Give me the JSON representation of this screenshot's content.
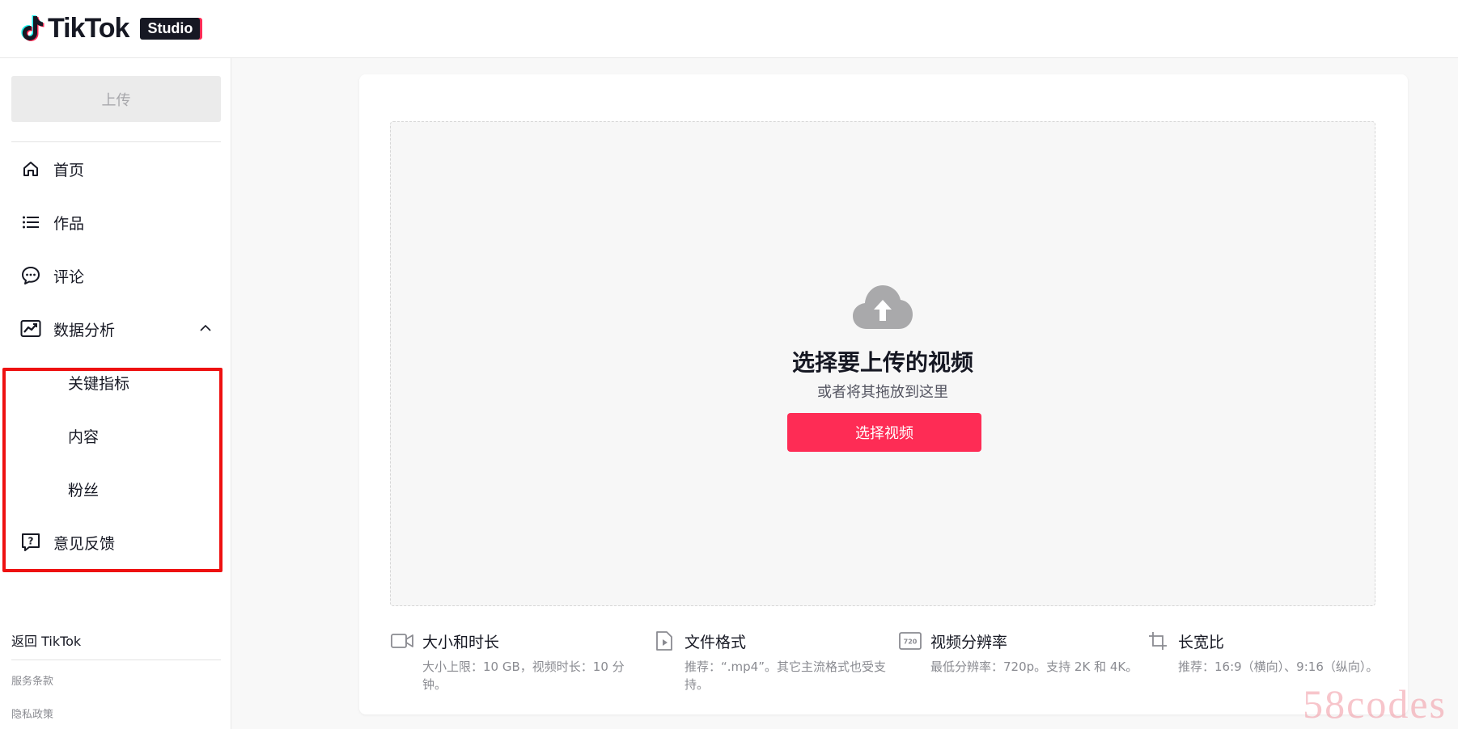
{
  "header": {
    "logo_text": "TikTok",
    "badge": "Studio"
  },
  "sidebar": {
    "upload_label": "上传",
    "items": [
      {
        "label": "首页",
        "icon": "home-icon"
      },
      {
        "label": "作品",
        "icon": "list-icon"
      },
      {
        "label": "评论",
        "icon": "comment-icon"
      },
      {
        "label": "数据分析",
        "icon": "analytics-icon",
        "expanded": true
      },
      {
        "label": "意见反馈",
        "icon": "feedback-icon"
      }
    ],
    "analytics_subitems": [
      "关键指标",
      "内容",
      "粉丝"
    ],
    "back_link": "返回 TikTok",
    "footer_links": [
      "服务条款",
      "隐私政策"
    ]
  },
  "upload": {
    "title": "选择要上传的视频",
    "subtitle": "或者将其拖放到这里",
    "button": "选择视频"
  },
  "info": [
    {
      "title": "大小和时长",
      "desc": "大小上限：10 GB，视频时长：10 分钟。",
      "icon": "video-camera-icon"
    },
    {
      "title": "文件格式",
      "desc": "推荐：“.mp4”。其它主流格式也受支持。",
      "icon": "file-icon"
    },
    {
      "title": "视频分辨率",
      "desc": "最低分辨率：720p。支持 2K 和 4K。",
      "icon": "resolution-720-icon",
      "icon_text": "720"
    },
    {
      "title": "长宽比",
      "desc": "推荐：16:9（横向）、9:16（纵向）。",
      "icon": "crop-icon"
    }
  ],
  "colors": {
    "accent": "#fe2c55",
    "highlight": "#ee1111"
  },
  "watermark": "58codes"
}
